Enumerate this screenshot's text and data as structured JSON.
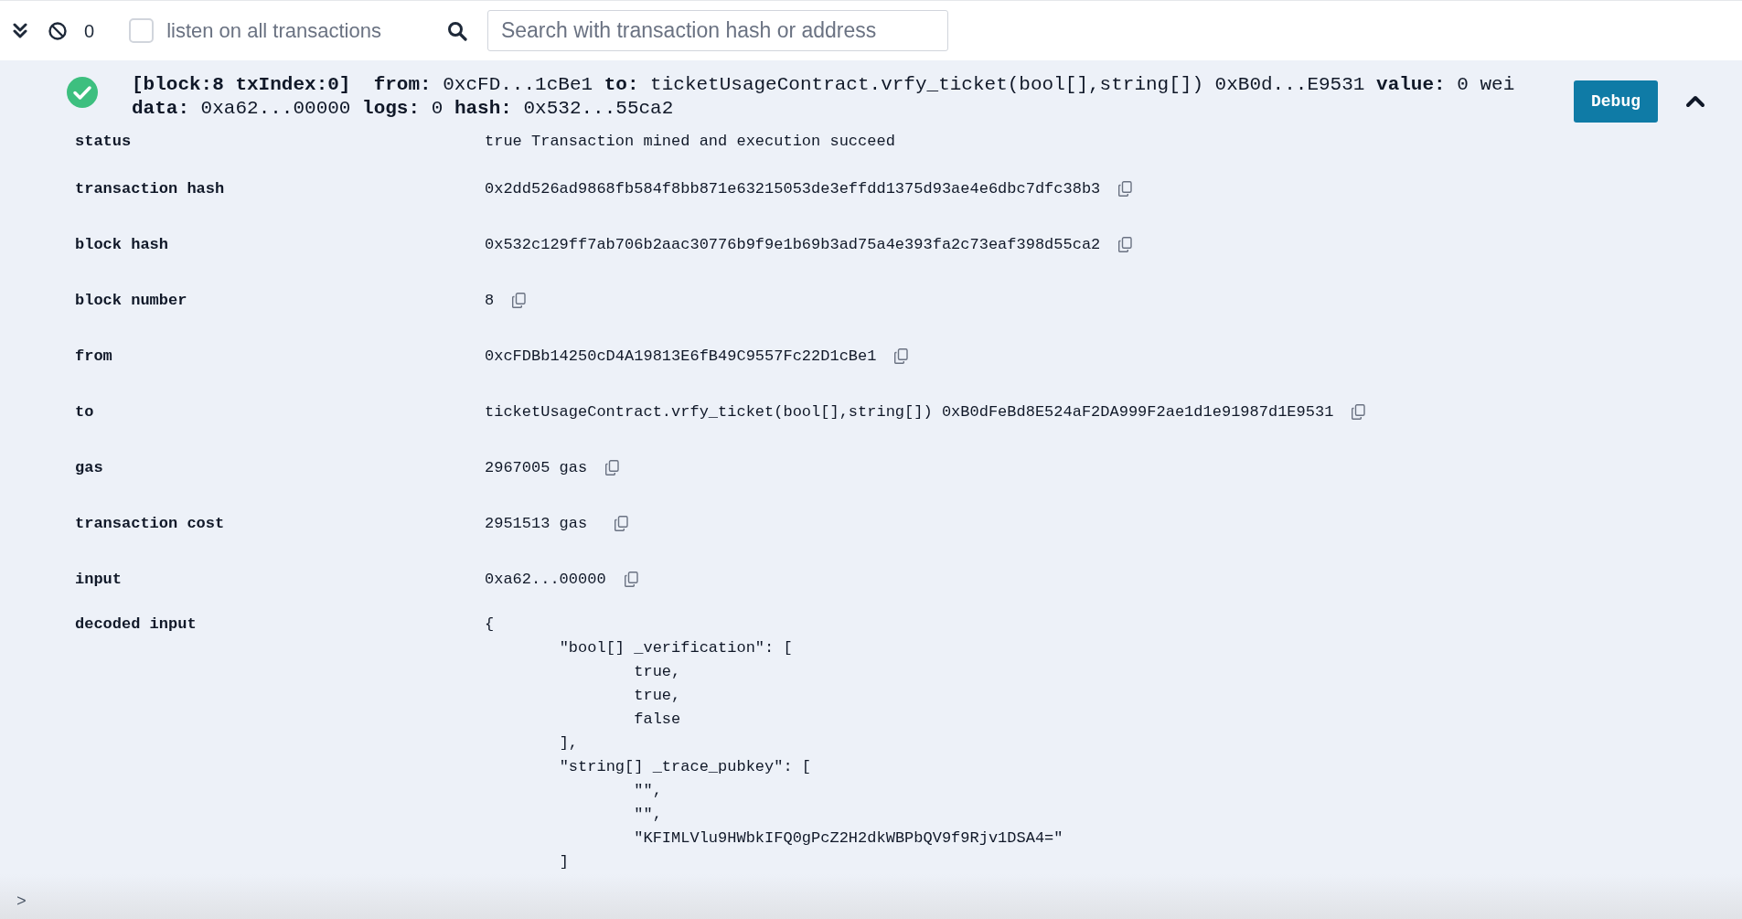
{
  "toolbar": {
    "counter": "0",
    "listen_checkbox": {
      "label": "listen on all transactions",
      "checked": false
    },
    "search": {
      "placeholder": "Search with transaction hash or address"
    }
  },
  "transaction": {
    "status_ok": true,
    "summary_lines": [
      "**[block:8 txIndex:0]  from:** 0xcFD...1cBe1 **to:** ticketUsageContract.vrfy_ticket(bool[],string[]) 0xB0d...E9531 **value:** 0 wei",
      "**data:** 0xa62...00000 **logs:** 0 **hash:** 0x532...55ca2"
    ],
    "debug_button": "Debug",
    "expanded": true,
    "details": [
      {
        "label": "status",
        "value": "true Transaction mined and execution succeed",
        "copy": false
      },
      {
        "label": "transaction hash",
        "value": "0x2dd526ad9868fb584f8bb871e63215053de3effdd1375d93ae4e6dbc7dfc38b3",
        "copy": true
      },
      {
        "label": "block hash",
        "value": "0x532c129ff7ab706b2aac30776b9f9e1b69b3ad75a4e393fa2c73eaf398d55ca2",
        "copy": true
      },
      {
        "label": "block number",
        "value": "8",
        "copy": true
      },
      {
        "label": "from",
        "value": "0xcFDBb14250cD4A19813E6fB49C9557Fc22D1cBe1",
        "copy": true
      },
      {
        "label": "to",
        "value": "ticketUsageContract.vrfy_ticket(bool[],string[]) 0xB0dFeBd8E524aF2DA999F2ae1d1e91987d1E9531",
        "copy": true
      },
      {
        "label": "gas",
        "value": "2967005 gas",
        "copy": true
      },
      {
        "label": "transaction cost",
        "value": "2951513 gas ",
        "copy": true
      },
      {
        "label": "input",
        "value": "0xa62...00000",
        "copy": true
      }
    ],
    "decoded_input": {
      "label": "decoded input",
      "code": "{\n\t\"bool[] _verification\": [\n\t\ttrue,\n\t\ttrue,\n\t\tfalse\n\t],\n\t\"string[] _trace_pubkey\": [\n\t\t\"\",\n\t\t\"\",\n\t\t\"KFIMLVlu9HWbkIFQ0gPcZ2H2dkWBPbQV9f9Rjv1DSA4=\"\n\t]"
    }
  },
  "prompt": ">"
}
